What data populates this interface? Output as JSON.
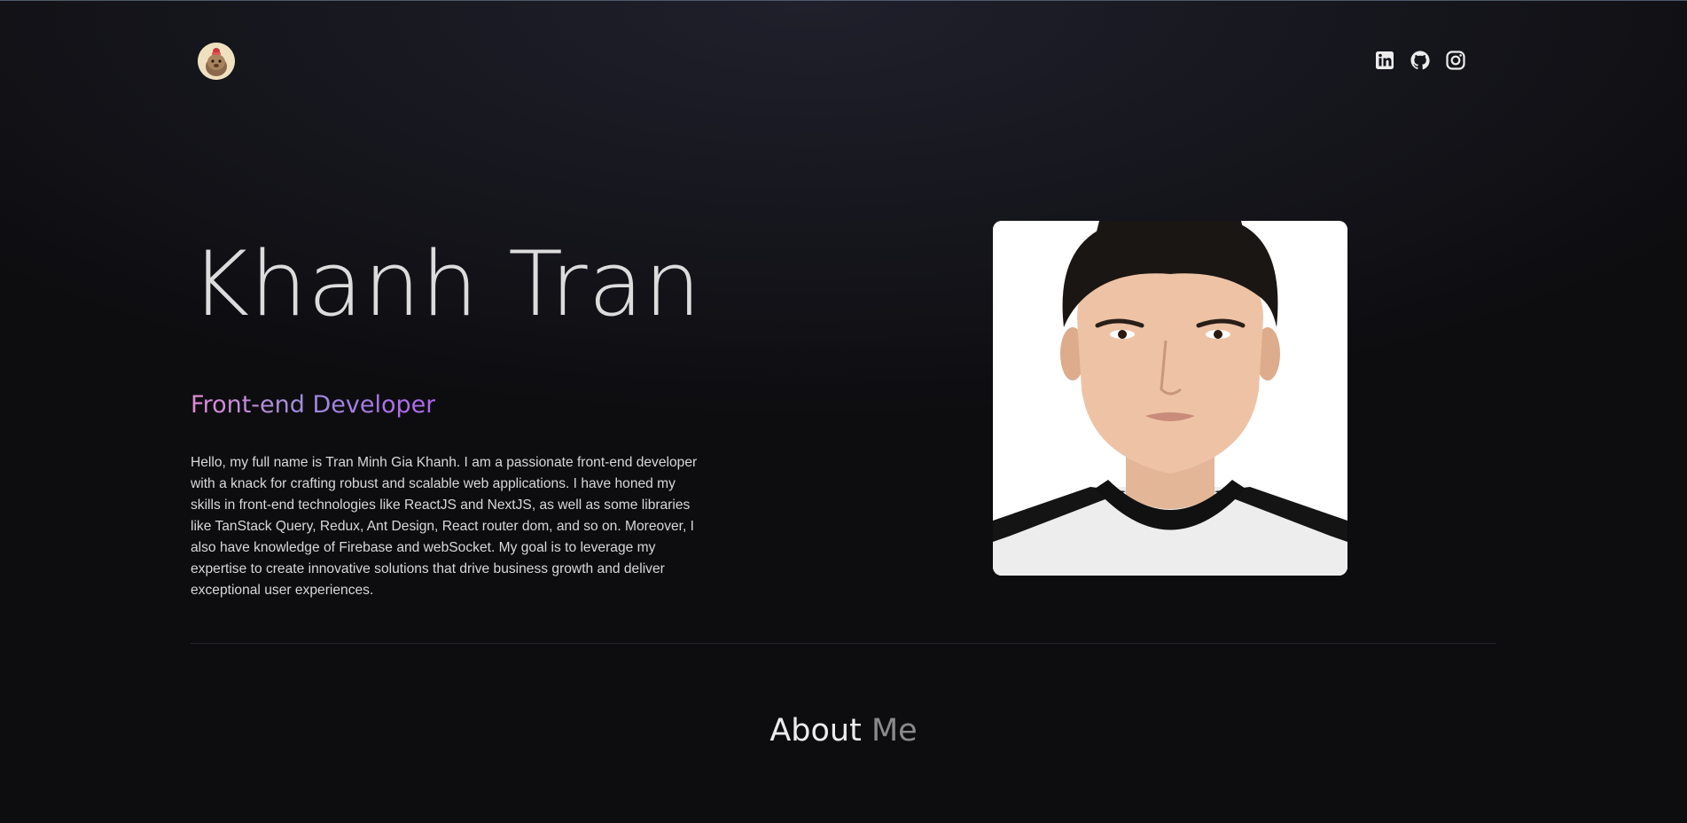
{
  "header": {
    "logo_icon": "avatar-logo-icon",
    "socials": [
      {
        "icon": "linkedin-icon",
        "label": "LinkedIn"
      },
      {
        "icon": "github-icon",
        "label": "GitHub"
      },
      {
        "icon": "instagram-icon",
        "label": "Instagram"
      }
    ]
  },
  "hero": {
    "name": "Khanh Tran",
    "role": "Front-end Developer",
    "bio": "Hello, my full name is Tran Minh Gia Khanh. I am a passionate front-end developer with a knack for crafting robust and scalable web applications. I have honed my skills in front-end technologies like ReactJS and NextJS, as well as some libraries like TanStack Query, Redux, Ant Design, React router dom, and so on. Moreover, I also have knowledge of Firebase and webSocket. My goal is to leverage my expertise to create innovative solutions that drive business growth and deliver exceptional user experiences."
  },
  "about": {
    "title_word1": "About",
    "title_word2": "Me"
  },
  "colors": {
    "background": "#0c0c0e",
    "role_gradient_start": "#e28ad3",
    "role_gradient_end": "#b066f0",
    "text": "#d8d8d8"
  }
}
